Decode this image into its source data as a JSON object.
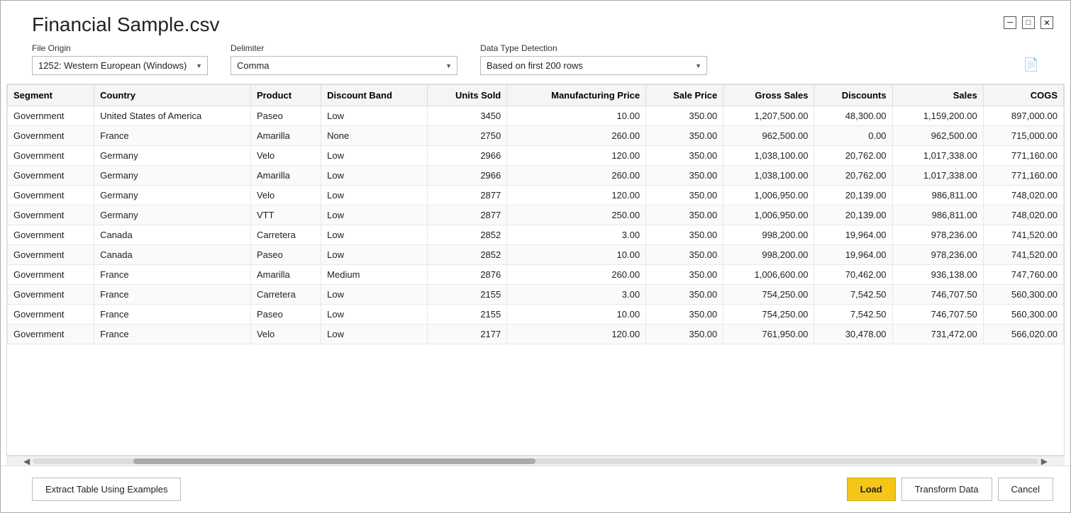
{
  "dialog": {
    "title": "Financial Sample.csv",
    "window_controls": {
      "minimize_label": "─",
      "maximize_label": "□",
      "close_label": "✕"
    }
  },
  "controls": {
    "file_origin_label": "File Origin",
    "file_origin_value": "1252: Western European (Windows)",
    "delimiter_label": "Delimiter",
    "delimiter_value": "Comma",
    "data_type_detection_label": "Data Type Detection",
    "data_type_detection_value": "Based on first 200 rows"
  },
  "table": {
    "columns": [
      {
        "key": "segment",
        "label": "Segment",
        "align": "left"
      },
      {
        "key": "country",
        "label": "Country",
        "align": "left"
      },
      {
        "key": "product",
        "label": "Product",
        "align": "left"
      },
      {
        "key": "discount_band",
        "label": "Discount Band",
        "align": "left"
      },
      {
        "key": "units_sold",
        "label": "Units Sold",
        "align": "right"
      },
      {
        "key": "manufacturing_price",
        "label": "Manufacturing Price",
        "align": "right"
      },
      {
        "key": "sale_price",
        "label": "Sale Price",
        "align": "right"
      },
      {
        "key": "gross_sales",
        "label": "Gross Sales",
        "align": "right"
      },
      {
        "key": "discounts",
        "label": "Discounts",
        "align": "right"
      },
      {
        "key": "sales",
        "label": "Sales",
        "align": "right"
      },
      {
        "key": "cogs",
        "label": "COGS",
        "align": "right"
      }
    ],
    "rows": [
      [
        "Government",
        "United States of America",
        "Paseo",
        "Low",
        "3450",
        "10.00",
        "350.00",
        "1,207,500.00",
        "48,300.00",
        "1,159,200.00",
        "897,000.00"
      ],
      [
        "Government",
        "France",
        "Amarilla",
        "None",
        "2750",
        "260.00",
        "350.00",
        "962,500.00",
        "0.00",
        "962,500.00",
        "715,000.00"
      ],
      [
        "Government",
        "Germany",
        "Velo",
        "Low",
        "2966",
        "120.00",
        "350.00",
        "1,038,100.00",
        "20,762.00",
        "1,017,338.00",
        "771,160.00"
      ],
      [
        "Government",
        "Germany",
        "Amarilla",
        "Low",
        "2966",
        "260.00",
        "350.00",
        "1,038,100.00",
        "20,762.00",
        "1,017,338.00",
        "771,160.00"
      ],
      [
        "Government",
        "Germany",
        "Velo",
        "Low",
        "2877",
        "120.00",
        "350.00",
        "1,006,950.00",
        "20,139.00",
        "986,811.00",
        "748,020.00"
      ],
      [
        "Government",
        "Germany",
        "VTT",
        "Low",
        "2877",
        "250.00",
        "350.00",
        "1,006,950.00",
        "20,139.00",
        "986,811.00",
        "748,020.00"
      ],
      [
        "Government",
        "Canada",
        "Carretera",
        "Low",
        "2852",
        "3.00",
        "350.00",
        "998,200.00",
        "19,964.00",
        "978,236.00",
        "741,520.00"
      ],
      [
        "Government",
        "Canada",
        "Paseo",
        "Low",
        "2852",
        "10.00",
        "350.00",
        "998,200.00",
        "19,964.00",
        "978,236.00",
        "741,520.00"
      ],
      [
        "Government",
        "France",
        "Amarilla",
        "Medium",
        "2876",
        "260.00",
        "350.00",
        "1,006,600.00",
        "70,462.00",
        "936,138.00",
        "747,760.00"
      ],
      [
        "Government",
        "France",
        "Carretera",
        "Low",
        "2155",
        "3.00",
        "350.00",
        "754,250.00",
        "7,542.50",
        "746,707.50",
        "560,300.00"
      ],
      [
        "Government",
        "France",
        "Paseo",
        "Low",
        "2155",
        "10.00",
        "350.00",
        "754,250.00",
        "7,542.50",
        "746,707.50",
        "560,300.00"
      ],
      [
        "Government",
        "France",
        "Velo",
        "Low",
        "2177",
        "120.00",
        "350.00",
        "761,950.00",
        "30,478.00",
        "731,472.00",
        "566,020.00"
      ]
    ]
  },
  "footer": {
    "extract_table_label": "Extract Table Using Examples",
    "load_label": "Load",
    "transform_data_label": "Transform Data",
    "cancel_label": "Cancel"
  }
}
